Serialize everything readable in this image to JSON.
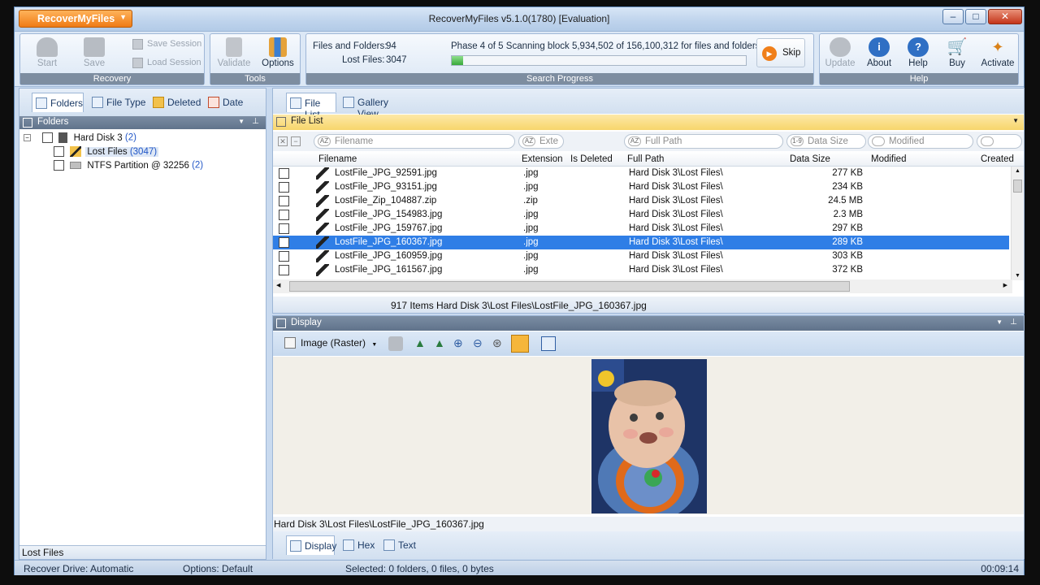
{
  "app_button": "RecoverMyFiles",
  "window_title": "RecoverMyFiles v5.1.0(1780) [Evaluation]",
  "window_controls": {
    "minimize": "–",
    "maximize": "□",
    "close": "✕"
  },
  "ribbon": {
    "recovery": {
      "caption": "Recovery",
      "start": "Start",
      "save": "Save",
      "save_session": "Save Session",
      "load_session": "Load Session"
    },
    "tools": {
      "caption": "Tools",
      "validate": "Validate",
      "options": "Options"
    },
    "search_progress": {
      "caption": "Search Progress",
      "files_and_folders_label": "Files and Folders:",
      "files_and_folders_value": "94",
      "lost_files_label": "Lost Files:",
      "lost_files_value": "3047",
      "phase_text": "Phase 4 of 5  Scanning block 5,934,502 of 156,100,312 for files and folders",
      "progress_fraction": 0.04,
      "skip": "Skip"
    },
    "help": {
      "caption": "Help",
      "update": "Update",
      "about": "About",
      "help": "Help",
      "buy": "Buy",
      "activate": "Activate"
    }
  },
  "left_pane": {
    "tabs": [
      "Folders",
      "File Type",
      "Deleted",
      "Date"
    ],
    "header": "Folders",
    "tree": [
      {
        "label": "Hard Disk 3",
        "count": "(2)"
      },
      {
        "label": "Lost Files",
        "count": "(3047)"
      },
      {
        "label": "NTFS Partition @ 32256",
        "count": "(2)"
      }
    ],
    "status": "Lost Files"
  },
  "right_pane": {
    "tabs": [
      "File List",
      "Gallery View"
    ],
    "header": "File List",
    "filters": {
      "filename": "Filename",
      "extension": "Exte",
      "full_path": "Full Path",
      "data_size": "Data Size",
      "modified": "Modified"
    },
    "columns": [
      "Filename",
      "Extension",
      "Is Deleted",
      "Full Path",
      "Data Size",
      "Modified",
      "Created"
    ],
    "rows": [
      {
        "filename": "LostFile_JPG_92591.jpg",
        "ext": ".jpg",
        "path": "Hard Disk 3\\Lost Files\\",
        "size": "277 KB"
      },
      {
        "filename": "LostFile_JPG_93151.jpg",
        "ext": ".jpg",
        "path": "Hard Disk 3\\Lost Files\\",
        "size": "234 KB"
      },
      {
        "filename": "LostFile_Zip_104887.zip",
        "ext": ".zip",
        "path": "Hard Disk 3\\Lost Files\\",
        "size": "24.5 MB"
      },
      {
        "filename": "LostFile_JPG_154983.jpg",
        "ext": ".jpg",
        "path": "Hard Disk 3\\Lost Files\\",
        "size": "2.3 MB"
      },
      {
        "filename": "LostFile_JPG_159767.jpg",
        "ext": ".jpg",
        "path": "Hard Disk 3\\Lost Files\\",
        "size": "297 KB"
      },
      {
        "filename": "LostFile_JPG_160367.jpg",
        "ext": ".jpg",
        "path": "Hard Disk 3\\Lost Files\\",
        "size": "289 KB"
      },
      {
        "filename": "LostFile_JPG_160959.jpg",
        "ext": ".jpg",
        "path": "Hard Disk 3\\Lost Files\\",
        "size": "303 KB"
      },
      {
        "filename": "LostFile_JPG_161567.jpg",
        "ext": ".jpg",
        "path": "Hard Disk 3\\Lost Files\\",
        "size": "372 KB"
      }
    ],
    "selected_row": 5,
    "status": "917 Items  Hard Disk 3\\Lost Files\\LostFile_JPG_160367.jpg"
  },
  "display_pane": {
    "header": "Display",
    "view_mode": "Image (Raster)",
    "status": "Hard Disk 3\\Lost Files\\LostFile_JPG_160367.jpg",
    "tabs": [
      "Display",
      "Hex",
      "Text"
    ]
  },
  "status_bar": {
    "recover_drive": "Recover Drive: Automatic",
    "options": "Options: Default",
    "selected": "Selected: 0 folders, 0 files, 0 bytes",
    "time": "00:09:14"
  },
  "colors": {
    "selection": "#2f7ee6",
    "accent": "#ef7b16",
    "link_count": "#2257c7"
  }
}
